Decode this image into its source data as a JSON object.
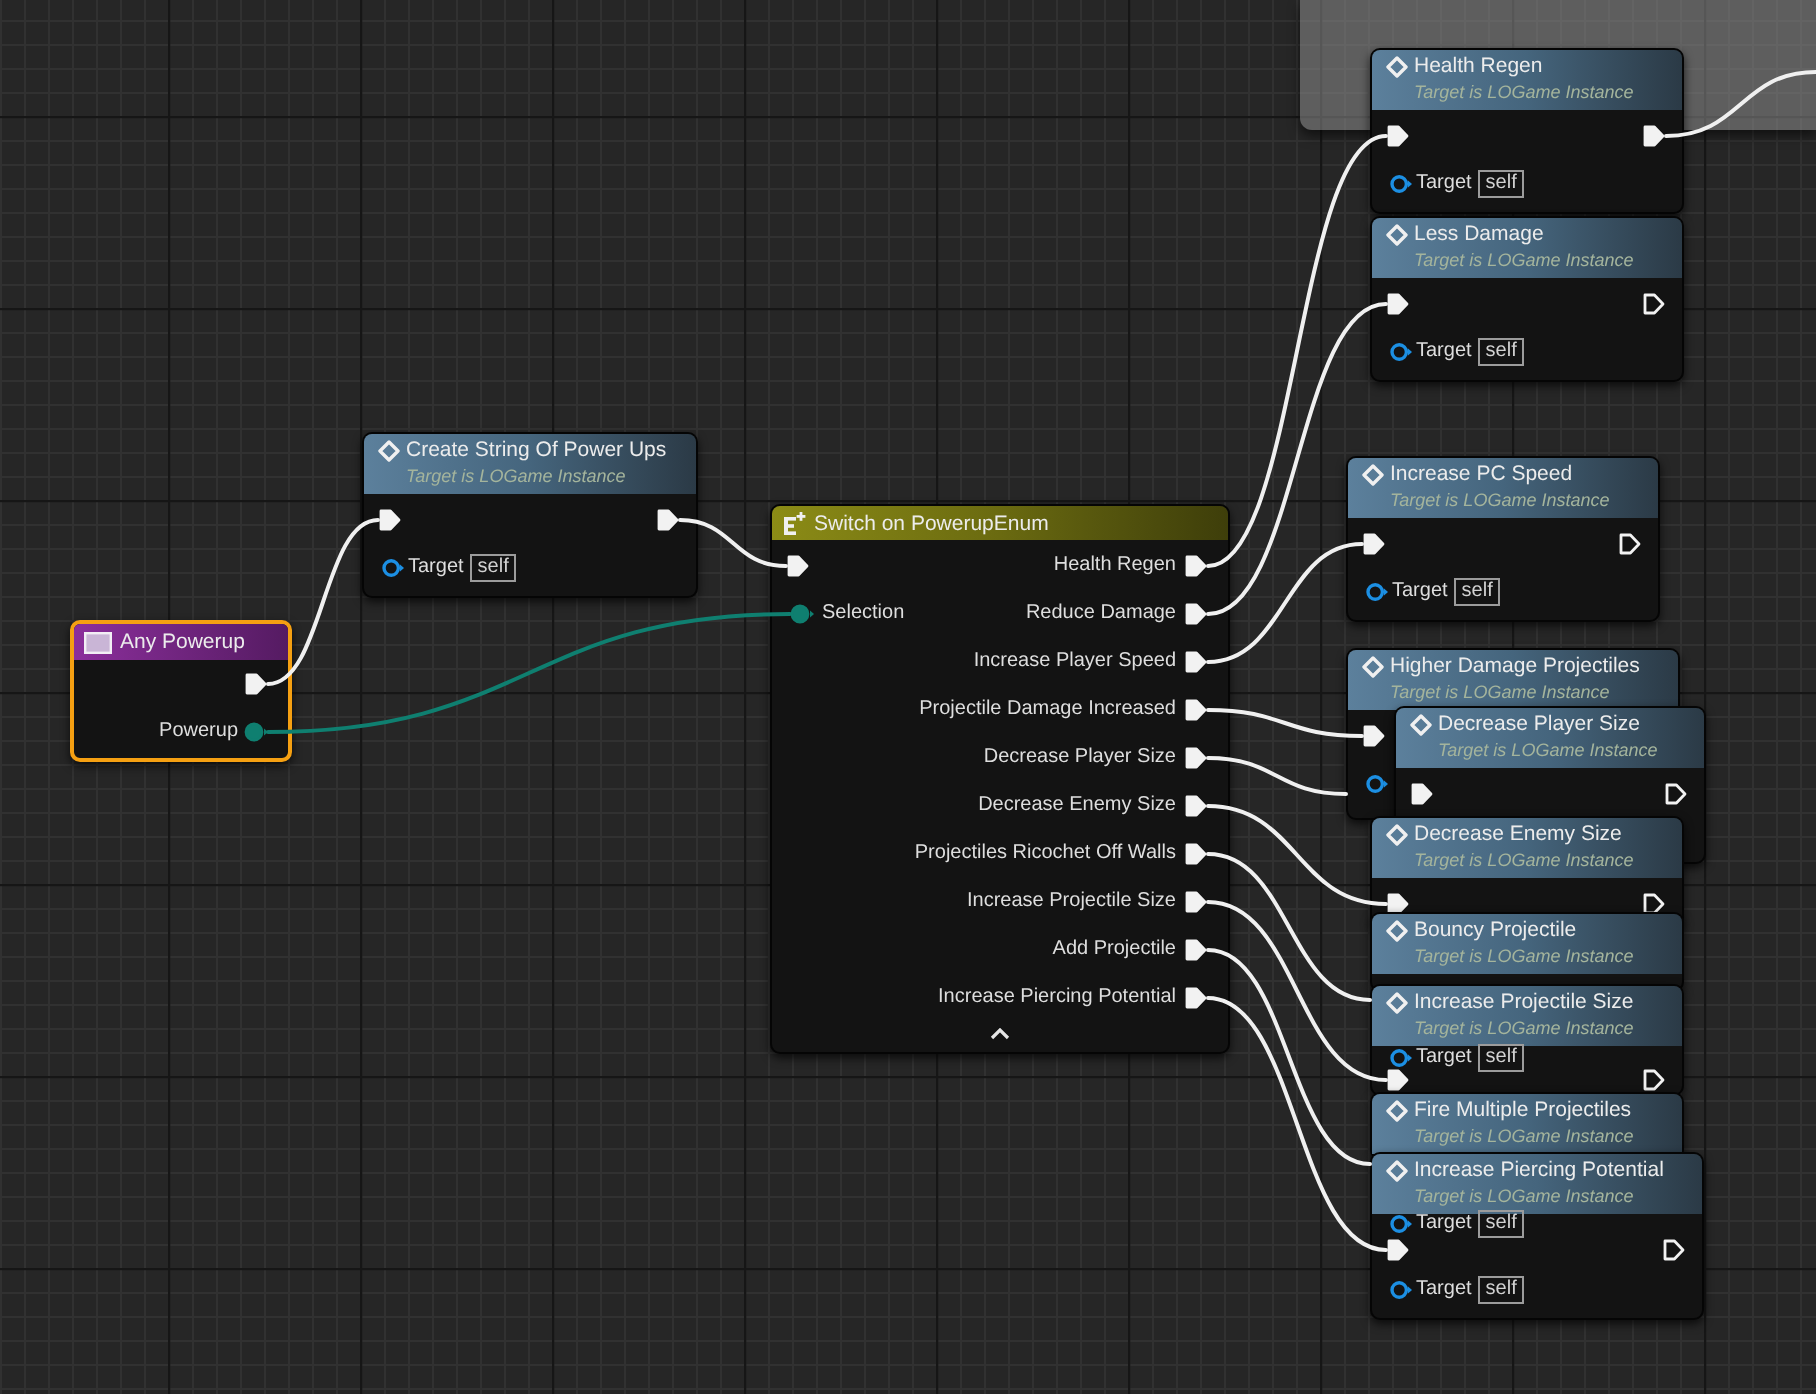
{
  "nodes": [
    {
      "kind": "event",
      "title": "Any Powerup",
      "selected": true,
      "outputs": [
        {
          "kind": "exec",
          "connected": true
        },
        {
          "kind": "enum",
          "label": "Powerup",
          "connected": true
        }
      ]
    },
    {
      "kind": "function",
      "title": "Create String Of Power Ups",
      "subtitle": "Target is LOGame Instance",
      "selected": false,
      "rows": [
        {
          "kind": "exec",
          "in": {
            "connected": true
          },
          "out": {
            "connected": true
          }
        },
        {
          "kind": "target",
          "label": "Target",
          "value": "self",
          "connected": false
        }
      ]
    },
    {
      "kind": "switch",
      "title": "Switch on PowerupEnum",
      "selected": false,
      "inputs": [
        {
          "kind": "exec",
          "connected": true
        },
        {
          "kind": "enum",
          "label": "Selection",
          "connected": true
        }
      ],
      "outputs": [
        {
          "label": "Health Regen",
          "connected": true
        },
        {
          "label": "Reduce Damage",
          "connected": true
        },
        {
          "label": "Increase Player Speed",
          "connected": true
        },
        {
          "label": "Projectile Damage Increased",
          "connected": true
        },
        {
          "label": "Decrease Player Size",
          "connected": true
        },
        {
          "label": "Decrease Enemy Size",
          "connected": true
        },
        {
          "label": "Projectiles Ricochet Off Walls",
          "connected": true
        },
        {
          "label": "Increase Projectile Size",
          "connected": true
        },
        {
          "label": "Add Projectile",
          "connected": true
        },
        {
          "label": "Increase Piercing Potential",
          "connected": true
        }
      ]
    },
    {
      "kind": "function",
      "title": "Health Regen",
      "subtitle": "Target is LOGame Instance",
      "selected": false,
      "rows": [
        {
          "kind": "exec",
          "in": {
            "connected": true
          },
          "out": {
            "connected": true
          }
        },
        {
          "kind": "target",
          "label": "Target",
          "value": "self",
          "connected": false
        }
      ]
    },
    {
      "kind": "function",
      "title": "Less Damage",
      "subtitle": "Target is LOGame Instance",
      "selected": false,
      "rows": [
        {
          "kind": "exec",
          "in": {
            "connected": true
          },
          "out": {
            "connected": false
          }
        },
        {
          "kind": "target",
          "label": "Target",
          "value": "self",
          "connected": false
        }
      ]
    },
    {
      "kind": "function",
      "title": "Increase PC Speed",
      "subtitle": "Target is LOGame Instance",
      "selected": false,
      "rows": [
        {
          "kind": "exec",
          "in": {
            "connected": true
          },
          "out": {
            "connected": false
          }
        },
        {
          "kind": "target",
          "label": "Target",
          "value": "self",
          "connected": false
        }
      ]
    },
    {
      "kind": "function",
      "title": "Higher Damage Projectiles",
      "subtitle": "Target is LOGame Instance",
      "selected": false,
      "rows": [
        {
          "kind": "exec",
          "in": {
            "connected": true
          }
        },
        {
          "kind": "target",
          "connected": false
        }
      ]
    },
    {
      "kind": "function",
      "title": "Decrease Player Size",
      "subtitle": "Target is LOGame Instance",
      "selected": false,
      "rows": [
        {
          "kind": "exec",
          "in": {
            "connected": true
          },
          "out": {
            "connected": false
          }
        }
      ]
    },
    {
      "kind": "function",
      "title": "Decrease Enemy Size",
      "subtitle": "Target is LOGame Instance",
      "selected": false,
      "rows": [
        {
          "kind": "exec",
          "in": {
            "connected": true
          },
          "out": {
            "connected": false
          }
        }
      ]
    },
    {
      "kind": "function",
      "title": "Bouncy Projectile",
      "subtitle": "Target is LOGame Instance",
      "selected": false
    },
    {
      "kind": "function",
      "title": "Increase Projectile Size",
      "subtitle": "Target is LOGame Instance",
      "selected": false,
      "rows": [
        {
          "kind": "target",
          "label": "Target",
          "value": "self",
          "connected": false
        },
        {
          "kind": "exec",
          "in": {
            "connected": true
          },
          "out": {
            "connected": false
          }
        }
      ]
    },
    {
      "kind": "function",
      "title": "Fire Multiple Projectiles",
      "subtitle": "Target is LOGame Instance",
      "selected": false
    },
    {
      "kind": "function",
      "title": "Increase Piercing Potential",
      "subtitle": "Target is LOGame Instance",
      "selected": false,
      "rows": [
        {
          "kind": "target",
          "label": "Target",
          "value": "self",
          "connected": false
        },
        {
          "kind": "exec",
          "in": {
            "connected": true
          },
          "out": {
            "connected": false
          }
        },
        {
          "kind": "target",
          "label": "Target",
          "value": "self",
          "connected": false
        }
      ]
    }
  ]
}
